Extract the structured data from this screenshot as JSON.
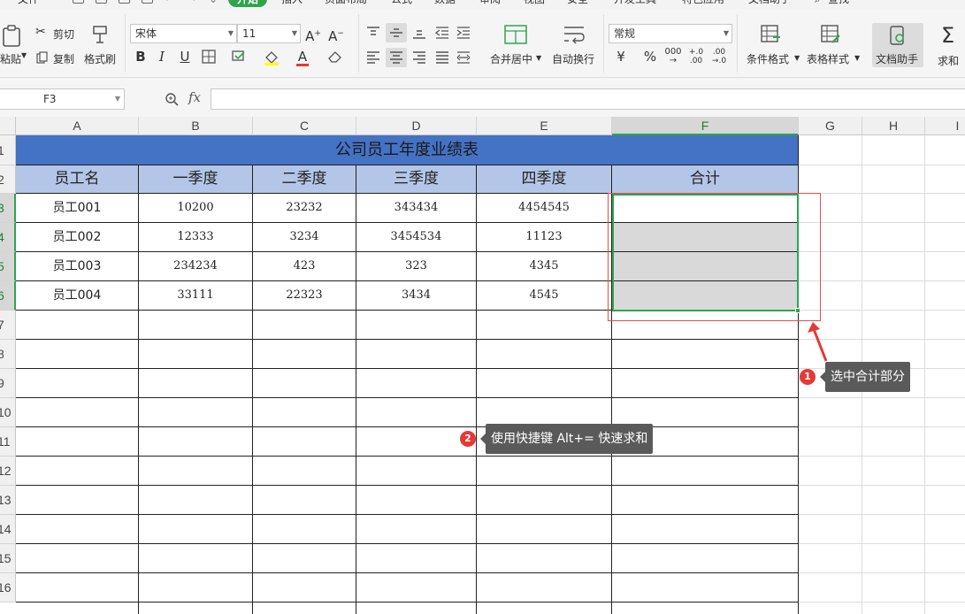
{
  "menu": {
    "items": [
      "文件",
      "开始",
      "插入",
      "页面布局",
      "公式",
      "数据",
      "审阅",
      "视图",
      "安全",
      "开发工具",
      "特色应用",
      "文档助手",
      "查找"
    ],
    "active_index": 1
  },
  "ribbon": {
    "paste": "粘贴",
    "cut": "剪切",
    "copy": "复制",
    "format_painter": "格式刷",
    "font_name": "宋体",
    "font_size": "11",
    "merge_center": "合并居中",
    "wrap_text": "自动换行",
    "number_format": "常规",
    "conditional_format": "条件格式",
    "table_style": "表格样式",
    "doc_assistant": "文档助手",
    "sum": "求和"
  },
  "formula_bar": {
    "name_box": "F3",
    "fx_label": "fx",
    "value": ""
  },
  "sheet": {
    "columns": [
      "A",
      "B",
      "C",
      "D",
      "E",
      "F",
      "G",
      "H",
      "I"
    ],
    "rows": [
      "1",
      "2",
      "3",
      "4",
      "5",
      "6",
      "7",
      "8",
      "9",
      "10",
      "11",
      "12",
      "13",
      "14",
      "15",
      "16"
    ],
    "title": "公司员工年度业绩表",
    "headers": [
      "员工名",
      "一季度",
      "二季度",
      "三季度",
      "四季度",
      "合计"
    ],
    "data": [
      [
        "员工001",
        "10200",
        "23232",
        "343434",
        "4454545",
        ""
      ],
      [
        "员工002",
        "12333",
        "3234",
        "3454534",
        "11123",
        ""
      ],
      [
        "员工003",
        "234234",
        "423",
        "323",
        "4345",
        ""
      ],
      [
        "员工004",
        "33111",
        "22323",
        "3434",
        "4545",
        ""
      ]
    ]
  },
  "annotations": {
    "step1": {
      "badge": "1",
      "text": "选中合计部分"
    },
    "step2": {
      "badge": "2",
      "text": "使用快捷键 Alt+= 快速求和"
    }
  },
  "colors": {
    "title_fill": "#4472c4",
    "header_fill": "#b4c6e7",
    "selection": "#2ea44f",
    "annotation_red": "#e53935"
  }
}
